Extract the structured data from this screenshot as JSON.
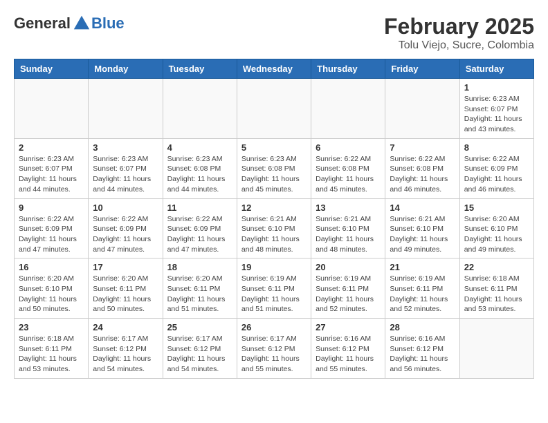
{
  "header": {
    "logo_general": "General",
    "logo_blue": "Blue",
    "main_title": "February 2025",
    "subtitle": "Tolu Viejo, Sucre, Colombia"
  },
  "days_of_week": [
    "Sunday",
    "Monday",
    "Tuesday",
    "Wednesday",
    "Thursday",
    "Friday",
    "Saturday"
  ],
  "weeks": [
    [
      {
        "day": "",
        "info": ""
      },
      {
        "day": "",
        "info": ""
      },
      {
        "day": "",
        "info": ""
      },
      {
        "day": "",
        "info": ""
      },
      {
        "day": "",
        "info": ""
      },
      {
        "day": "",
        "info": ""
      },
      {
        "day": "1",
        "info": "Sunrise: 6:23 AM\nSunset: 6:07 PM\nDaylight: 11 hours\nand 43 minutes."
      }
    ],
    [
      {
        "day": "2",
        "info": "Sunrise: 6:23 AM\nSunset: 6:07 PM\nDaylight: 11 hours\nand 44 minutes."
      },
      {
        "day": "3",
        "info": "Sunrise: 6:23 AM\nSunset: 6:07 PM\nDaylight: 11 hours\nand 44 minutes."
      },
      {
        "day": "4",
        "info": "Sunrise: 6:23 AM\nSunset: 6:08 PM\nDaylight: 11 hours\nand 44 minutes."
      },
      {
        "day": "5",
        "info": "Sunrise: 6:23 AM\nSunset: 6:08 PM\nDaylight: 11 hours\nand 45 minutes."
      },
      {
        "day": "6",
        "info": "Sunrise: 6:22 AM\nSunset: 6:08 PM\nDaylight: 11 hours\nand 45 minutes."
      },
      {
        "day": "7",
        "info": "Sunrise: 6:22 AM\nSunset: 6:08 PM\nDaylight: 11 hours\nand 46 minutes."
      },
      {
        "day": "8",
        "info": "Sunrise: 6:22 AM\nSunset: 6:09 PM\nDaylight: 11 hours\nand 46 minutes."
      }
    ],
    [
      {
        "day": "9",
        "info": "Sunrise: 6:22 AM\nSunset: 6:09 PM\nDaylight: 11 hours\nand 47 minutes."
      },
      {
        "day": "10",
        "info": "Sunrise: 6:22 AM\nSunset: 6:09 PM\nDaylight: 11 hours\nand 47 minutes."
      },
      {
        "day": "11",
        "info": "Sunrise: 6:22 AM\nSunset: 6:09 PM\nDaylight: 11 hours\nand 47 minutes."
      },
      {
        "day": "12",
        "info": "Sunrise: 6:21 AM\nSunset: 6:10 PM\nDaylight: 11 hours\nand 48 minutes."
      },
      {
        "day": "13",
        "info": "Sunrise: 6:21 AM\nSunset: 6:10 PM\nDaylight: 11 hours\nand 48 minutes."
      },
      {
        "day": "14",
        "info": "Sunrise: 6:21 AM\nSunset: 6:10 PM\nDaylight: 11 hours\nand 49 minutes."
      },
      {
        "day": "15",
        "info": "Sunrise: 6:20 AM\nSunset: 6:10 PM\nDaylight: 11 hours\nand 49 minutes."
      }
    ],
    [
      {
        "day": "16",
        "info": "Sunrise: 6:20 AM\nSunset: 6:10 PM\nDaylight: 11 hours\nand 50 minutes."
      },
      {
        "day": "17",
        "info": "Sunrise: 6:20 AM\nSunset: 6:11 PM\nDaylight: 11 hours\nand 50 minutes."
      },
      {
        "day": "18",
        "info": "Sunrise: 6:20 AM\nSunset: 6:11 PM\nDaylight: 11 hours\nand 51 minutes."
      },
      {
        "day": "19",
        "info": "Sunrise: 6:19 AM\nSunset: 6:11 PM\nDaylight: 11 hours\nand 51 minutes."
      },
      {
        "day": "20",
        "info": "Sunrise: 6:19 AM\nSunset: 6:11 PM\nDaylight: 11 hours\nand 52 minutes."
      },
      {
        "day": "21",
        "info": "Sunrise: 6:19 AM\nSunset: 6:11 PM\nDaylight: 11 hours\nand 52 minutes."
      },
      {
        "day": "22",
        "info": "Sunrise: 6:18 AM\nSunset: 6:11 PM\nDaylight: 11 hours\nand 53 minutes."
      }
    ],
    [
      {
        "day": "23",
        "info": "Sunrise: 6:18 AM\nSunset: 6:11 PM\nDaylight: 11 hours\nand 53 minutes."
      },
      {
        "day": "24",
        "info": "Sunrise: 6:17 AM\nSunset: 6:12 PM\nDaylight: 11 hours\nand 54 minutes."
      },
      {
        "day": "25",
        "info": "Sunrise: 6:17 AM\nSunset: 6:12 PM\nDaylight: 11 hours\nand 54 minutes."
      },
      {
        "day": "26",
        "info": "Sunrise: 6:17 AM\nSunset: 6:12 PM\nDaylight: 11 hours\nand 55 minutes."
      },
      {
        "day": "27",
        "info": "Sunrise: 6:16 AM\nSunset: 6:12 PM\nDaylight: 11 hours\nand 55 minutes."
      },
      {
        "day": "28",
        "info": "Sunrise: 6:16 AM\nSunset: 6:12 PM\nDaylight: 11 hours\nand 56 minutes."
      },
      {
        "day": "",
        "info": ""
      }
    ]
  ]
}
